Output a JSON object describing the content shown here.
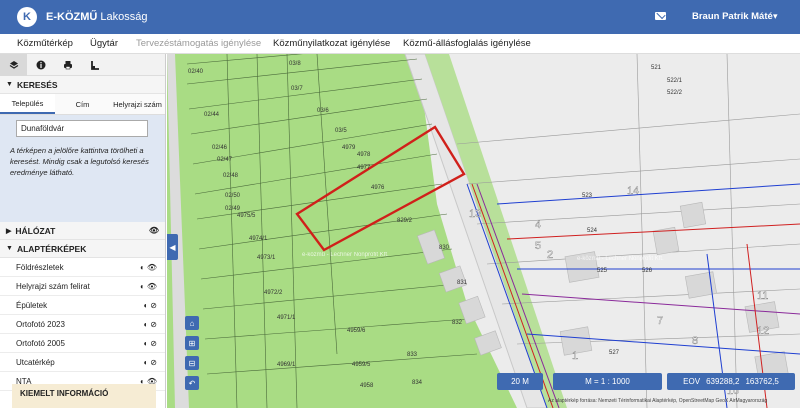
{
  "header": {
    "logo_letter": "K",
    "app_name": "E-KÖZMŰ",
    "app_subtitle": "Lakosság",
    "user": "Braun Patrik Máté",
    "user_chevron": "▾",
    "accent": "#3f6ab1"
  },
  "nav": [
    {
      "label": "Közműtérkép",
      "disabled": false
    },
    {
      "label": "Ügytár",
      "disabled": false
    },
    {
      "label": "Tervezéstámogatás igénylése",
      "disabled": true
    },
    {
      "label": "Közműnyilatkozat igénylése",
      "disabled": false
    },
    {
      "label": "Közmű-állásfoglalás igénylése",
      "disabled": false
    }
  ],
  "sidebar": {
    "tools": [
      "layers-icon",
      "info-icon",
      "print-icon",
      "measure-icon"
    ],
    "search": {
      "title": "KERESÉS",
      "tabs": [
        "Település",
        "Cím",
        "Helyrajzi szám"
      ],
      "value": "Dunaföldvár",
      "hint": "A térképen a jelölőre kattintva törölheti a keresést. Mindig csak a legutolsó keresés eredménye látható."
    },
    "halozat": "HÁLÓZAT",
    "alapterkepek": "ALAPTÉRKÉPEK",
    "layers": [
      {
        "label": "Földrészletek",
        "visible": true
      },
      {
        "label": "Helyrajzi szám felirat",
        "visible": true
      },
      {
        "label": "Épületek",
        "visible": false
      },
      {
        "label": "Ortofotó 2023",
        "visible": false
      },
      {
        "label": "Ortofotó 2005",
        "visible": false
      },
      {
        "label": "Utcatérkép",
        "visible": false
      },
      {
        "label": "NTA",
        "visible": true
      }
    ],
    "kiemelt": "KIEMELT INFORMÁCIÓ"
  },
  "map": {
    "status_scale_bar": "20 M",
    "status_ratio": "M = 1 : 1000",
    "status_eov_label": "EOV",
    "status_eov_x": "639288,2",
    "status_eov_y": "163762,5",
    "attribution": "Az alaptérkép forrása: Nemzeti Térinformatikai Alaptérkép, OpenStreetMap GeoX AirMagyarország",
    "watermark": "e-közmű - Lechner Nonprofit Kft.",
    "parcel_labels": [
      "02/40",
      "03/8",
      "03/7",
      "03/6",
      "02/44",
      "02/46",
      "02/47",
      "02/48",
      "02/50",
      "02/49",
      "03/5",
      "4979",
      "4978",
      "4977",
      "4976",
      "4975/5",
      "4974/1",
      "4973/1",
      "4972/2",
      "4971/1",
      "4969/1",
      "829/2",
      "830",
      "831",
      "832",
      "833",
      "834",
      "4959/6",
      "4959/5",
      "4958",
      "521",
      "522/1",
      "522/2",
      "523",
      "524",
      "525",
      "526",
      "527",
      "13",
      "4",
      "5",
      "2",
      "1",
      "11",
      "12",
      "7",
      "8",
      "10",
      "14"
    ],
    "colors": {
      "green": "#a9dc84",
      "grey": "#eeeeee",
      "building": "#dedede",
      "highlight": "#d0201a",
      "utility_blue": "#1f3fd1",
      "utility_red": "#d02020",
      "utility_purple": "#8a2a9a"
    }
  }
}
